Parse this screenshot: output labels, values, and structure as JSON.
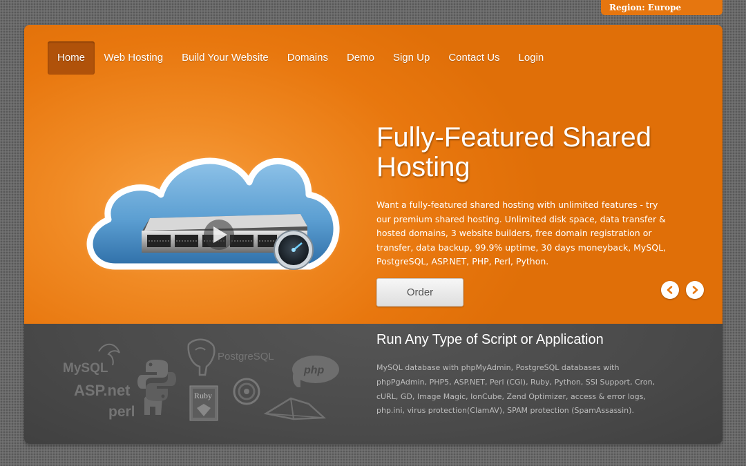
{
  "region": {
    "label": "Region: Europe"
  },
  "nav": {
    "items": [
      {
        "label": "Home"
      },
      {
        "label": "Web Hosting"
      },
      {
        "label": "Build Your Website"
      },
      {
        "label": "Domains"
      },
      {
        "label": "Demo"
      },
      {
        "label": "Sign Up"
      },
      {
        "label": "Contact Us"
      },
      {
        "label": "Login"
      }
    ],
    "active_index": 0
  },
  "hero": {
    "title": "Fully-Featured Shared Hosting",
    "description": "Want a fully-featured shared hosting with unlimited features - try our premium shared hosting. Unlimited disk space, data transfer & hosted domains, 3 website builders, free domain registration or transfer, data backup, 99.9% uptime, 30 days moneyback, MySQL, PostgreSQL, ASP.NET, PHP, Perl, Python.",
    "order_label": "Order",
    "image_icon": "cloud-server-icon",
    "prev_icon": "chevron-left-icon",
    "next_icon": "chevron-right-icon"
  },
  "scripts": {
    "title": "Run Any Type of Script or Application",
    "description": "MySQL database with phpMyAdmin, PostgreSQL databases with phpPgAdmin, PHP5, ASP.NET, Perl (CGI), Ruby, Python, SSI Support, Cron, cURL, GD, Image Magic, IonCube, Zend Optimizer, access & error logs, php.ini, virus protection(ClamAV), SPAM protection (SpamAssassin).",
    "logos": {
      "mysql": "MySQL",
      "aspnet": "ASP.net",
      "perl": "perl",
      "postgresql": "PostgreSQL",
      "php": "php",
      "ruby": "Ruby"
    }
  },
  "colors": {
    "accent": "#e8770e",
    "nav_active": "#b0520a",
    "dark_panel": "#4a4a4a"
  }
}
